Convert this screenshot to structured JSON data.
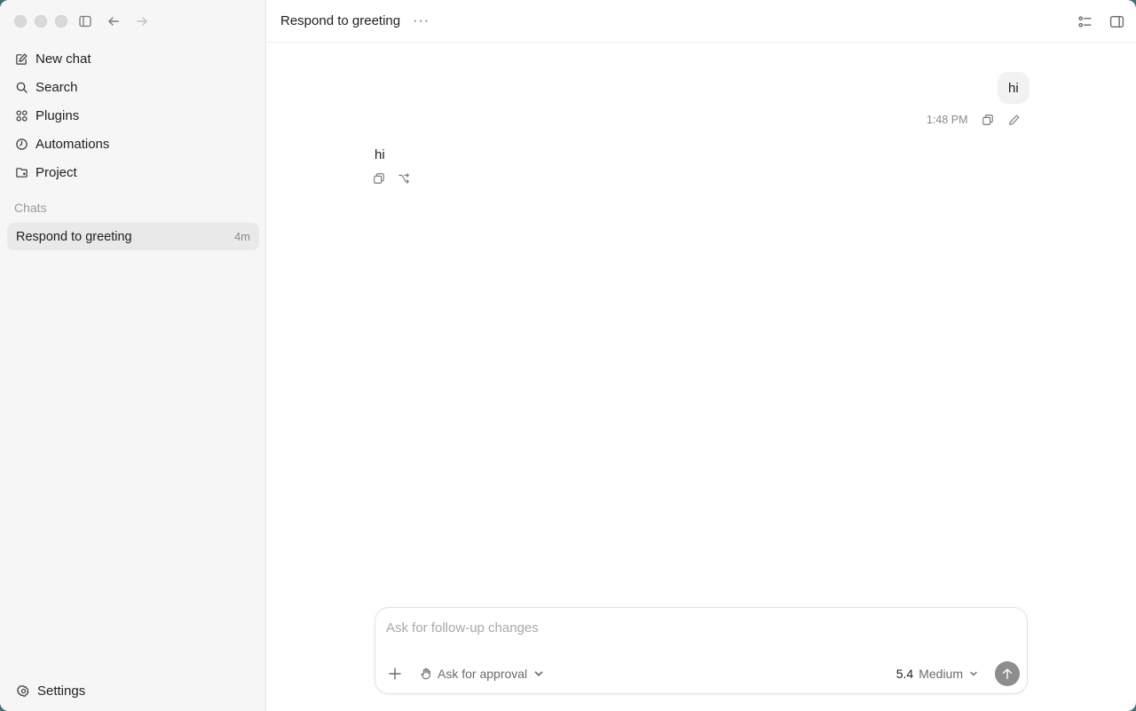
{
  "sidebar": {
    "nav": [
      {
        "label": "New chat",
        "icon": "new-chat-icon"
      },
      {
        "label": "Search",
        "icon": "search-icon"
      },
      {
        "label": "Plugins",
        "icon": "plugins-icon"
      },
      {
        "label": "Automations",
        "icon": "automations-icon"
      },
      {
        "label": "Project",
        "icon": "project-icon"
      }
    ],
    "section_label": "Chats",
    "chats": [
      {
        "title": "Respond to greeting",
        "age": "4m"
      }
    ],
    "settings_label": "Settings"
  },
  "header": {
    "title": "Respond to greeting",
    "more": "···"
  },
  "conversation": {
    "user_message": "hi",
    "user_time": "1:48 PM",
    "assistant_message": "hi"
  },
  "composer": {
    "placeholder": "Ask for follow-up changes",
    "approval_label": "Ask for approval",
    "model_version": "5.4",
    "model_effort": "Medium"
  },
  "colors": {
    "sidebar_bg": "#f6f6f6",
    "active_chat_bg": "#e9e9e9",
    "send_button": "#8d8d8d"
  }
}
